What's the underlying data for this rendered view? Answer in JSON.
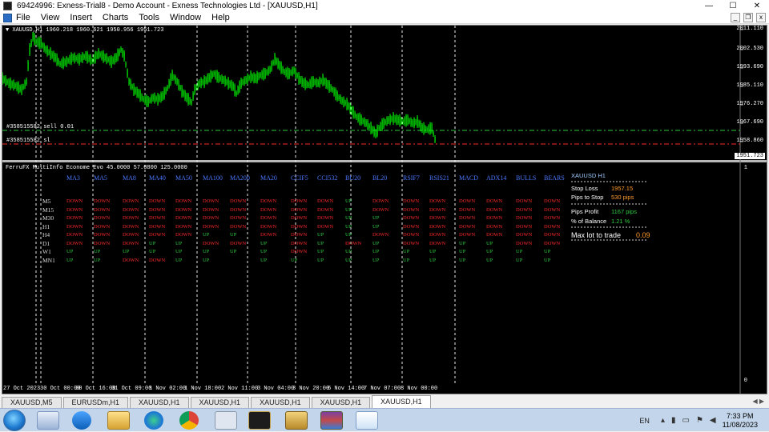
{
  "window": {
    "title": "69424996: Exness-Trial8 - Demo Account - Exness Technologies Ltd - [XAUUSD,H1]",
    "buttons": {
      "minimize": "—",
      "maximize": "☐",
      "close": "✕"
    }
  },
  "menu": {
    "items": [
      "File",
      "View",
      "Insert",
      "Charts",
      "Tools",
      "Window",
      "Help"
    ],
    "mdi_buttons": {
      "minimize": "_",
      "restore": "❐",
      "close": "x"
    }
  },
  "chart": {
    "symbol_line": "▼ XAUUSD,H1  1960.218 1960.621 1950.956 1951.723",
    "price_axis": [
      "2011.110",
      "2002.530",
      "1993.690",
      "1985.110",
      "1976.270",
      "1967.690",
      "1958.860"
    ],
    "current_price": "1951.723",
    "orders": [
      {
        "label": "#358515582 sell 0.01",
        "color": "#2ecc40"
      },
      {
        "label": "#358515582 sl",
        "color": "#ff2a2a"
      }
    ],
    "candle_color": "#00ff00",
    "time_axis": [
      "27 Oct 2023",
      "30 Oct 00:00",
      "30 Oct 16:00",
      "31 Oct 09:00",
      "1 Nov 02:00",
      "1 Nov 18:00",
      "2 Nov 11:00",
      "3 Nov 04:00",
      "3 Nov 20:00",
      "6 Nov 14:00",
      "7 Nov 07:00",
      "8 Nov 00:00"
    ]
  },
  "indicator": {
    "title": "FerruFX MultiInfo Econome Evo 45.0000 57.0800 125.0000",
    "scale_top": "1",
    "scale_bottom": "0",
    "columns": [
      "MA3",
      "MA5",
      "MA8",
      "MA40",
      "MA50",
      "MA100",
      "MA200",
      "MA20",
      "CCIF5",
      "CCI532",
      "BU20",
      "BL20",
      "RSIF7",
      "RSIS21",
      "MACD",
      "ADX14",
      "BULLS",
      "BEARS"
    ],
    "timeframes": [
      "M5",
      "M15",
      "M30",
      "H1",
      "H4",
      "D1",
      "W1",
      "MN1"
    ],
    "rows": [
      [
        "DOWN",
        "DOWN",
        "DOWN",
        "DOWN",
        "DOWN",
        "DOWN",
        "DOWN",
        "DOWN",
        "DOWN",
        "DOWN",
        "UP",
        "DOWN",
        "DOWN",
        "DOWN",
        "DOWN",
        "DOWN",
        "DOWN",
        "DOWN"
      ],
      [
        "DOWN",
        "DOWN",
        "DOWN",
        "DOWN",
        "DOWN",
        "DOWN",
        "DOWN",
        "DOWN",
        "DOWN",
        "DOWN",
        "UP",
        "DOWN",
        "DOWN",
        "DOWN",
        "DOWN",
        "DOWN",
        "DOWN",
        "DOWN"
      ],
      [
        "DOWN",
        "DOWN",
        "DOWN",
        "DOWN",
        "DOWN",
        "DOWN",
        "DOWN",
        "DOWN",
        "DOWN",
        "DOWN",
        "UP",
        "UP",
        "DOWN",
        "DOWN",
        "DOWN",
        "DOWN",
        "DOWN",
        "DOWN"
      ],
      [
        "DOWN",
        "DOWN",
        "DOWN",
        "DOWN",
        "DOWN",
        "DOWN",
        "DOWN",
        "DOWN",
        "DOWN",
        "DOWN",
        "UP",
        "UP",
        "DOWN",
        "DOWN",
        "DOWN",
        "DOWN",
        "DOWN",
        "DOWN"
      ],
      [
        "DOWN",
        "DOWN",
        "DOWN",
        "DOWN",
        "DOWN",
        "UP",
        "UP",
        "DOWN",
        "DOWN",
        "UP",
        "UP",
        "DOWN",
        "DOWN",
        "DOWN",
        "DOWN",
        "DOWN",
        "DOWN",
        "DOWN"
      ],
      [
        "DOWN",
        "DOWN",
        "DOWN",
        "UP",
        "UP",
        "DOWN",
        "DOWN",
        "UP",
        "DOWN",
        "UP",
        "DOWN",
        "UP",
        "DOWN",
        "DOWN",
        "UP",
        "UP",
        "DOWN",
        "DOWN"
      ],
      [
        "UP",
        "UP",
        "UP",
        "UP",
        "UP",
        "UP",
        "UP",
        "UP",
        "DOWN",
        "UP",
        "UP",
        "UP",
        "UP",
        "UP",
        "UP",
        "UP",
        "UP",
        "UP"
      ],
      [
        "UP",
        "UP",
        "DOWN",
        "DOWN",
        "UP",
        "UP",
        "",
        "UP",
        "UP",
        "UP",
        "UP",
        "UP",
        "UP",
        "UP",
        "UP",
        "UP",
        "UP",
        "UP"
      ]
    ],
    "colors": {
      "up": "#2ecc40",
      "down": "#ff2a2a",
      "header": "#4a78ff"
    }
  },
  "info_panel": {
    "symbol": "XAUUSD  H1",
    "stop_loss_label": "Stop Loss",
    "stop_loss_value": "1957.15",
    "pips_to_stop_label": "Pips to Stop",
    "pips_to_stop_value": "530 pips",
    "pips_profit_label": "Pips Profit",
    "pips_profit_value": "1167 pips",
    "pct_balance_label": "% of Balance",
    "pct_balance_value": "1.21 %",
    "max_lot_label": "Max lot to trade",
    "max_lot_value": "0.09"
  },
  "tabs": {
    "items": [
      "XAUUSD,M5",
      "EURUSDm,H1",
      "XAUUSD,H1",
      "XAUUSD,H1",
      "XAUUSD,H1",
      "XAUUSD,H1",
      "XAUUSD,H1"
    ],
    "active_index": 6,
    "scroll": "◀ ▶"
  },
  "taskbar": {
    "language": "EN",
    "time": "7:33 PM",
    "date": "11/08/2023"
  }
}
